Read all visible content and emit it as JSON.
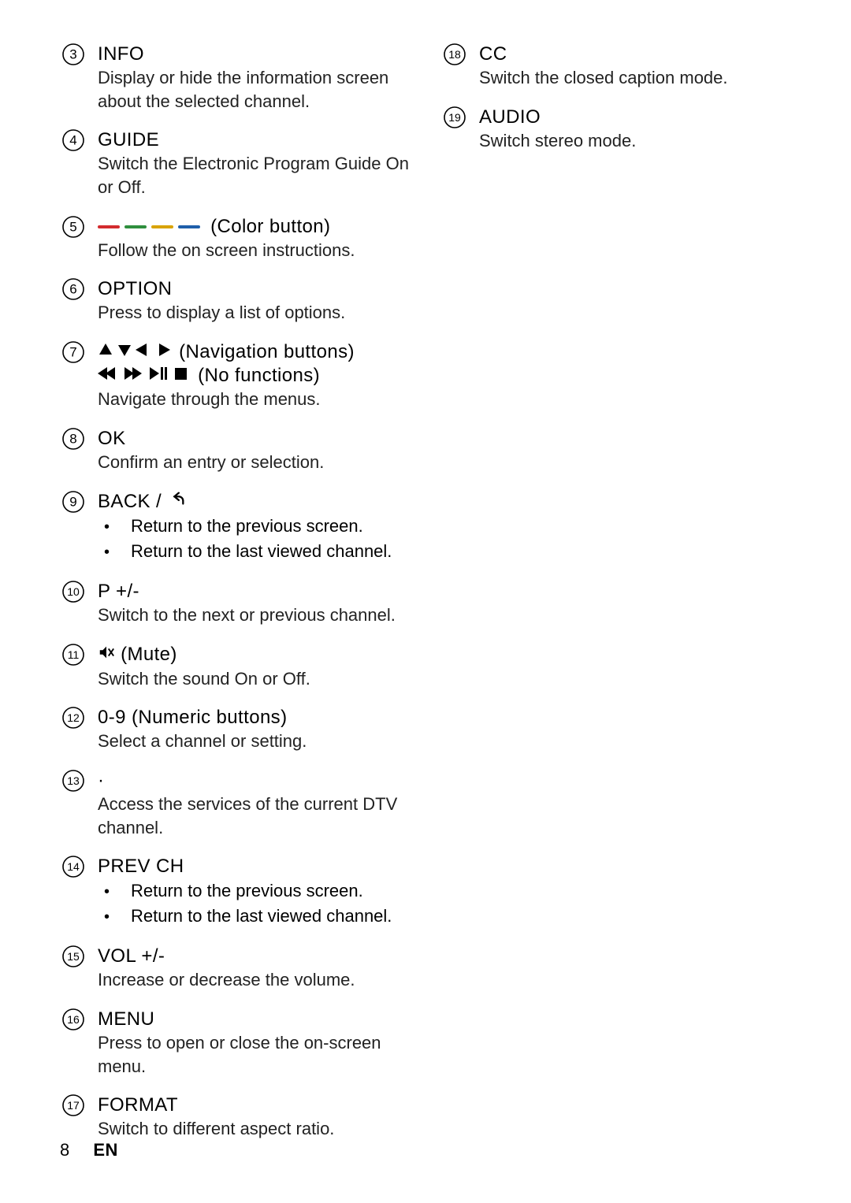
{
  "footer": {
    "page_number": "8",
    "lang": "EN"
  },
  "left": [
    {
      "num": "3",
      "title_plain": "INFO",
      "desc": "Display or hide the information screen about the selected channel."
    },
    {
      "num": "4",
      "title_plain": "GUIDE",
      "desc": "Switch the Electronic Program Guide On or Off."
    },
    {
      "num": "5",
      "title_kind": "color_button",
      "title_suffix": "(Color button)",
      "desc": "Follow the on screen instructions."
    },
    {
      "num": "6",
      "title_plain": "OPTION",
      "desc": "Press to display a list of options."
    },
    {
      "num": "7",
      "title_kind": "navigation",
      "nav_label": "(Navigation buttons)",
      "nofunc_label": "(No functions)",
      "desc": "Navigate through the menus."
    },
    {
      "num": "8",
      "title_plain": "OK",
      "desc": "Confirm an entry or selection."
    },
    {
      "num": "9",
      "title_kind": "back",
      "back_label": "BACK /",
      "bullets": [
        "Return to the previous screen.",
        "Return to the last viewed channel."
      ]
    },
    {
      "num": "10",
      "title_plain": "P +/-",
      "desc": "Switch to the next or previous channel."
    },
    {
      "num": "11",
      "title_kind": "mute",
      "mute_label": "(Mute)",
      "desc": "Switch the sound On or Off."
    },
    {
      "num": "12",
      "title_plain": "0-9 (Numeric buttons)",
      "desc": "Select a channel or setting."
    },
    {
      "num": "13",
      "title_plain": "·",
      "desc": "Access the services of the current DTV channel."
    },
    {
      "num": "14",
      "title_plain": "PREV CH",
      "bullets": [
        "Return to the previous screen.",
        "Return to the last viewed channel."
      ]
    },
    {
      "num": "15",
      "title_plain": "VOL +/-",
      "desc": "Increase or decrease the volume."
    },
    {
      "num": "16",
      "title_plain": "MENU",
      "desc": "Press to open or close the on-screen menu."
    },
    {
      "num": "17",
      "title_plain": "FORMAT",
      "desc": "Switch to different aspect ratio."
    }
  ],
  "right": [
    {
      "num": "18",
      "title_plain": "CC",
      "desc": "Switch the closed caption mode."
    },
    {
      "num": "19",
      "title_plain": "AUDIO",
      "desc": "Switch stereo mode."
    }
  ]
}
